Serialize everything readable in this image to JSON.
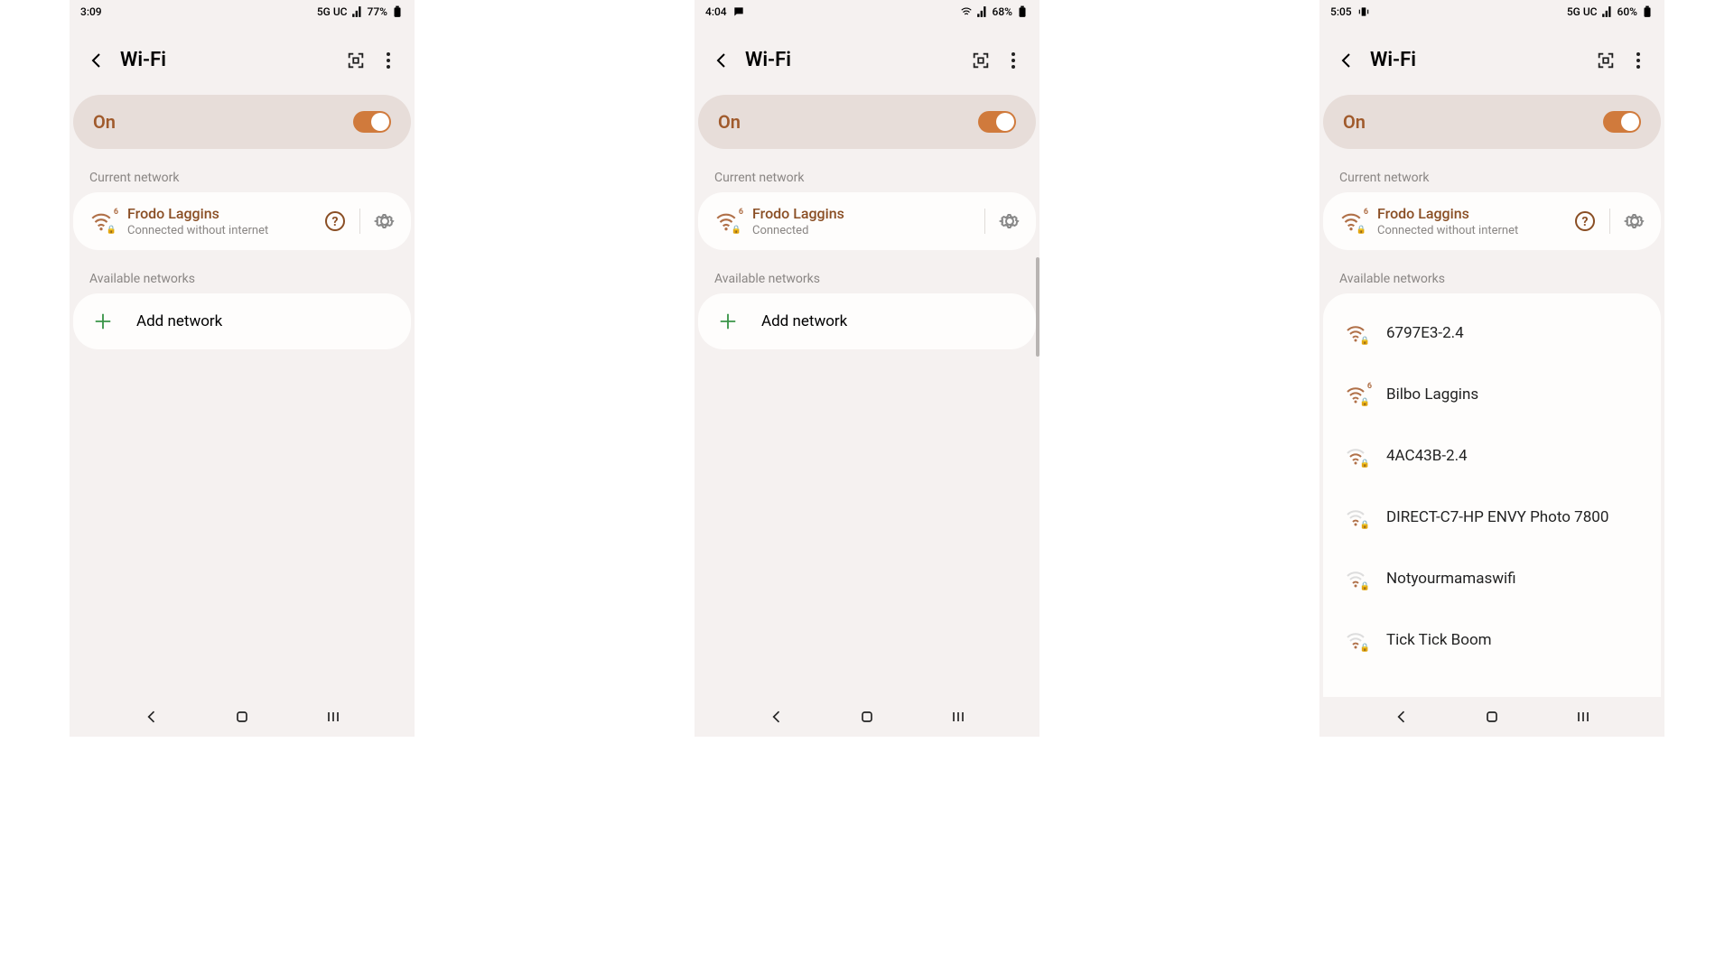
{
  "panels": [
    {
      "status": {
        "time": "3:09",
        "network_type": "5G UC",
        "battery": "77%"
      },
      "title": "Wi-Fi",
      "toggle_label": "On",
      "current_label": "Current network",
      "current_network": {
        "name": "Frodo Laggins",
        "status": "Connected without internet",
        "show_help": true
      },
      "available_label": "Available networks",
      "add_label": "Add network",
      "networks": []
    },
    {
      "status": {
        "time": "4:04",
        "network_type": "",
        "battery": "68%",
        "show_chat": true,
        "show_wifi_status": true
      },
      "title": "Wi-Fi",
      "toggle_label": "On",
      "current_label": "Current network",
      "current_network": {
        "name": "Frodo Laggins",
        "status": "Connected",
        "show_help": false
      },
      "available_label": "Available networks",
      "add_label": "Add network",
      "networks": [],
      "show_scroll": true
    },
    {
      "status": {
        "time": "5:05",
        "network_type": "5G UC",
        "battery": "60%",
        "show_vibrate": true
      },
      "title": "Wi-Fi",
      "toggle_label": "On",
      "current_label": "Current network",
      "current_network": {
        "name": "Frodo Laggins",
        "status": "Connected without internet",
        "show_help": true
      },
      "available_label": "Available networks",
      "add_label": "Add network",
      "networks": [
        {
          "name": "6797E3-2.4",
          "strength": "medium",
          "six": false
        },
        {
          "name": "Bilbo Laggins",
          "strength": "strong",
          "six": true
        },
        {
          "name": "4AC43B-2.4",
          "strength": "medium",
          "six": false
        },
        {
          "name": "DIRECT-C7-HP ENVY Photo 7800",
          "strength": "weak",
          "six": false
        },
        {
          "name": "Notyourmamaswifi",
          "strength": "weak",
          "six": false
        },
        {
          "name": "Tick Tick Boom",
          "strength": "weak",
          "six": false
        }
      ]
    }
  ]
}
